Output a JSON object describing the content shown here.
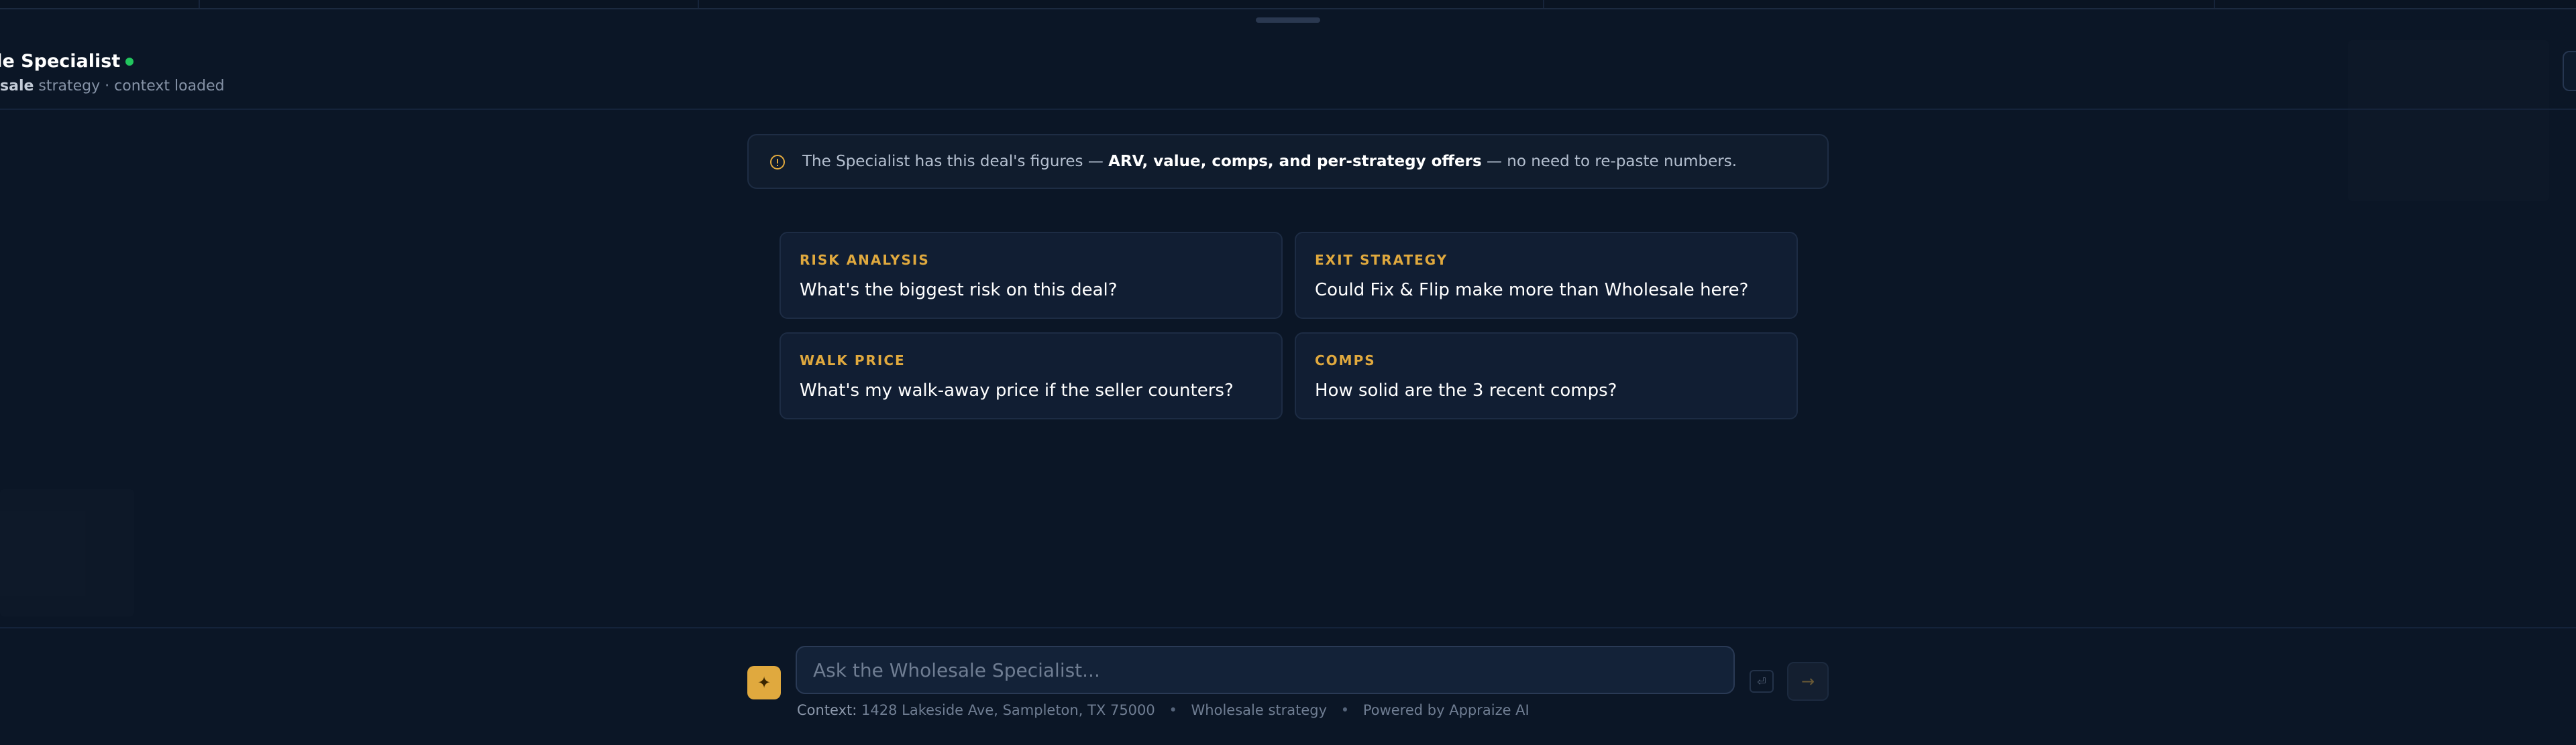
{
  "header": {
    "title": "ale Specialist",
    "subtitle_strong": "sale",
    "subtitle_rest": " strategy · context loaded"
  },
  "banner": {
    "prefix": "The Specialist has this deal's figures — ",
    "bold": "ARV, value, comps, and per-strategy offers",
    "suffix": " — no need to re-paste numbers."
  },
  "suggestions": [
    {
      "tag": "RISK ANALYSIS",
      "question": "What's the biggest risk on this deal?"
    },
    {
      "tag": "EXIT STRATEGY",
      "question": "Could Fix & Flip make more than Wholesale here?"
    },
    {
      "tag": "WALK PRICE",
      "question": "What's my walk-away price if the seller counters?"
    },
    {
      "tag": "COMPS",
      "question": "How solid are the 3 recent comps?"
    }
  ],
  "composer": {
    "placeholder": "Ask the Wholesale Specialist...",
    "spark_icon": "✦",
    "enter_icon": "⏎",
    "send_icon": "→"
  },
  "footer": {
    "context_label": "Context:",
    "address": "1428 Lakeside Ave, Sampleton, TX 75000",
    "strategy": "Wholesale strategy",
    "powered": "Powered by Appraize AI",
    "separator": "•"
  },
  "colors": {
    "background": "#0b1626",
    "accent": "#e0a93e",
    "status_online": "#22c55e"
  }
}
